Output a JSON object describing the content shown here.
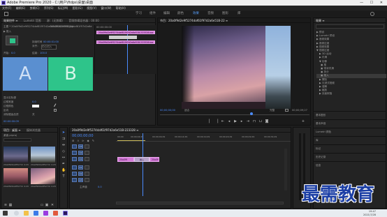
{
  "app": {
    "title": "Adobe Premiere Pro 2020 - C:\\用户\\ftdps\\桌面\\桌面",
    "window_controls": "—  ☐  ✕"
  },
  "menu": [
    "文件(F)",
    "编辑(E)",
    "剪辑(C)",
    "序列(S)",
    "标记(M)",
    "图形(G)",
    "视图(V)",
    "窗口(W)",
    "帮助(H)"
  ],
  "workspaces": [
    "学习",
    "组件",
    "编辑",
    "颜色",
    "效果",
    "音频",
    "图形",
    "库"
  ],
  "active_workspace": "效果",
  "effect_controls": {
    "tabs": [
      "效果控件 ≡",
      "Lumetri 范围",
      "源：(无剪辑)",
      "音频剪辑混合器：00:00"
    ],
    "source": "主要 * 20a0f9d2e9f5274daf61f97d2a6e51B-223328.jpg",
    "sequence": "20a0f9d2e9f5274daf61f97d2a6e51B-22 * 推入",
    "effect_name": "▶ 推入",
    "duration_label": "持续时间",
    "duration_value": "00:00:01:00",
    "alignment_label": "对齐：",
    "alignment_value": "中心切入",
    "start_label": "开始：",
    "start_value": "0.0",
    "end_label": "结束：",
    "end_value": "100.0",
    "show_actual_label": "显示实际源",
    "border_width_label": "边框宽度",
    "border_width_value": "0.0",
    "border_color_label": "边框颜色",
    "reverse_label": "反向",
    "antialias_label": "消除锯齿品质",
    "antialias_value": "关",
    "a_label": "A",
    "b_label": "B",
    "mini_time": "00:00:00:00",
    "mini_clip1": "20a0f9d2e9f5274daf61f97d2a6e51B-223328.jpg",
    "mini_clip2": "20a0f9d2e9f5274daf61f97d2a6e51B-223328.jpg",
    "footer_time": "00:00:00:09"
  },
  "program": {
    "title": "节目：20a0f9d2e9f5274daf61f97d2a6e51B-22 ≡",
    "timecode_left": "00;00;00;00",
    "fit": "适合",
    "quality": "完整",
    "timecode_right": "00;00;09;27"
  },
  "project": {
    "tabs": [
      "项目：桌面 ≡",
      "媒体浏览器",
      "库"
    ],
    "file": "桌面.prproj",
    "items": [
      {
        "name": "20a0f9d2e9f5274daf...",
        "dur": "4:29"
      },
      {
        "name": "20a0f9d2e9f5274daf...",
        "dur": "4:29"
      },
      {
        "name": "20a0f9d2e9f5274daf...",
        "dur": "4:29"
      },
      {
        "name": "20a0f9d2e9f5274daf...",
        "dur": "4:29"
      }
    ]
  },
  "timeline": {
    "title": "20a0f9d2e9f5274daf61f97d2a6e51B-223328 ≡",
    "timecode": "00;00;00;00",
    "ruler": [
      "00;00",
      "00;00;04;29",
      "00;00;09;29",
      "00;00;14;29",
      "00;00;19;29",
      "00;00;24;29",
      "00;00;29;29",
      "00;00;34;29"
    ],
    "tracks": [
      "V3",
      "V2",
      "V1",
      "A1",
      "A2",
      "A3"
    ],
    "mix_label": "主声道",
    "mix_value": "0.0",
    "clip_label": "20a0f9",
    "transition_label": "推入",
    "clip2_label": "20a0f9d2e9f5"
  },
  "effects_panel": {
    "title": "效果 ≡",
    "tree": [
      "▶ 预设",
      "▶ Lumetri 预设",
      "▶ 音频效果",
      "▶ 音频过渡",
      "▶ 视频效果",
      "▼ 视频过渡",
      "▶ 3D 运动",
      "▶ 内滑",
      "▼ 划像",
      "  ▣ 推",
      "  ▣ 带状内滑",
      "  ▣ 拆分",
      "  ▣ 推入",
      "▶ 擦除",
      "▶ 沉浸式视频",
      "▶ 溶解",
      "▶ 缩放",
      "▶ 页面剥落"
    ],
    "sections": [
      "基本图形",
      "基本声音",
      "Lumetri 颜色",
      "库",
      "标记",
      "历史记录",
      "信息"
    ]
  },
  "taskbar": {
    "time": "19:47",
    "date": "2021/7/28"
  },
  "watermark": "最需教育",
  "colors": {
    "accent": "#4b8cff",
    "clip": "#d47ad8",
    "a_block": "#5a8fd0",
    "b_block": "#2ec48a",
    "watermark": "#1c3fa5"
  }
}
